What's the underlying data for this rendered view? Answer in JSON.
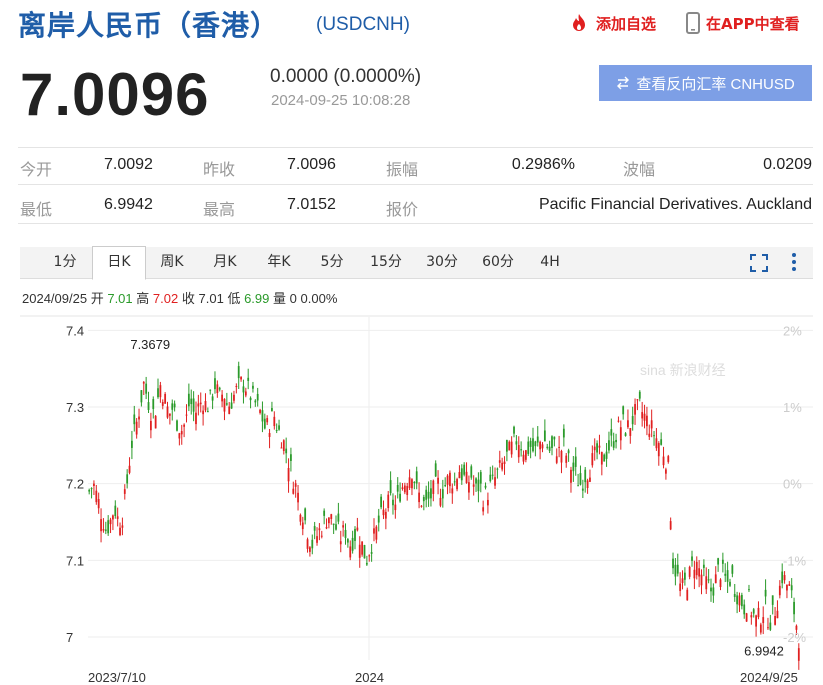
{
  "header": {
    "title": "离岸人民币（香港）",
    "code": "(USDCNH)",
    "add_favorite": "添加自选",
    "view_in_app": "在APP中查看"
  },
  "quote": {
    "price": "7.0096",
    "change": "0.0000 (0.0000%)",
    "timestamp": "2024-09-25 10:08:28",
    "reverse_button": "查看反向汇率 CNHUSD"
  },
  "stats": {
    "open_label": "今开",
    "open": "7.0092",
    "prev_close_label": "昨收",
    "prev_close": "7.0096",
    "amplitude_label": "振幅",
    "amplitude": "0.2986%",
    "range_label": "波幅",
    "range": "0.0209",
    "low_label": "最低",
    "low": "6.9942",
    "high_label": "最高",
    "high": "7.0152",
    "quote_label": "报价",
    "quote_source": "Pacific Financial Derivatives. Auckland"
  },
  "tabs": [
    "1分",
    "日K",
    "周K",
    "月K",
    "年K",
    "5分",
    "15分",
    "30分",
    "60分",
    "4H"
  ],
  "active_tab": "日K",
  "ohlc": {
    "date": "2024/09/25",
    "open_label": "开",
    "open": "7.01",
    "high_label": "高",
    "high": "7.02",
    "close_label": "收",
    "close": "7.01",
    "low_label": "低",
    "low": "6.99",
    "volume_label": "量",
    "volume": "0",
    "pct": "0.00%"
  },
  "watermark": "sina 新浪财经",
  "colors": {
    "up": "#e02020",
    "down": "#2a9a2a",
    "brand": "#1f5da8",
    "button": "#7d9fe6"
  },
  "chart_data": {
    "type": "candlestick",
    "yticks": [
      "7.4",
      "7.3",
      "7.2",
      "7.1",
      "7"
    ],
    "ytick_values": [
      7.4,
      7.3,
      7.2,
      7.1,
      7.0
    ],
    "right_ticks": [
      "2%",
      "1%",
      "0%",
      "-1%",
      "-2%"
    ],
    "ylim": [
      6.97,
      7.42
    ],
    "xticks": [
      "2023/7/10",
      "2024",
      "2024/9/25"
    ],
    "annotations": [
      {
        "text": "7.3679",
        "index": 17,
        "value": 7.3679
      },
      {
        "text": "6.9942",
        "index": 295,
        "value": 6.9942
      }
    ],
    "close_series": [
      7.19,
      7.2,
      7.18,
      7.16,
      7.14,
      7.15,
      7.17,
      7.15,
      7.16,
      7.2,
      7.25,
      7.27,
      7.3,
      7.33,
      7.31,
      7.29,
      7.3,
      7.33,
      7.31,
      7.29,
      7.3,
      7.28,
      7.27,
      7.28,
      7.31,
      7.29,
      7.3,
      7.31,
      7.3,
      7.31,
      7.33,
      7.31,
      7.32,
      7.3,
      7.31,
      7.32,
      7.33,
      7.33,
      7.32,
      7.31,
      7.3,
      7.29,
      7.27,
      7.28,
      7.29,
      7.27,
      7.26,
      7.24,
      7.22,
      7.2,
      7.18,
      7.16,
      7.14,
      7.12,
      7.13,
      7.14,
      7.15,
      7.16,
      7.15,
      7.14,
      7.13,
      7.14,
      7.12,
      7.13,
      7.14,
      7.12,
      7.1,
      7.12,
      7.13,
      7.15,
      7.16,
      7.17,
      7.18,
      7.17,
      7.19,
      7.2,
      7.21,
      7.22,
      7.19,
      7.18,
      7.17,
      7.18,
      7.19,
      7.2,
      7.19,
      7.2,
      7.21,
      7.2,
      7.22,
      7.21,
      7.2,
      7.21,
      7.19,
      7.2,
      7.18,
      7.19,
      7.2,
      7.21,
      7.22,
      7.23,
      7.24,
      7.25,
      7.26,
      7.25,
      7.24,
      7.25,
      7.24,
      7.25,
      7.26,
      7.25,
      7.24,
      7.25,
      7.24,
      7.25,
      7.23,
      7.22,
      7.21,
      7.2,
      7.21,
      7.22,
      7.23,
      7.24,
      7.23,
      7.24,
      7.25,
      7.26,
      7.27,
      7.28,
      7.27,
      7.28,
      7.29,
      7.3,
      7.29,
      7.28,
      7.27,
      7.26,
      7.25,
      7.24,
      7.22,
      7.1,
      7.08,
      7.06,
      7.07,
      7.08,
      7.1,
      7.09,
      7.08,
      7.07,
      7.06,
      7.07,
      7.09,
      7.08,
      7.07,
      7.08,
      7.06,
      7.05,
      7.04,
      7.05,
      7.03,
      7.02,
      7.03,
      7.04,
      7.02,
      7.03,
      7.05,
      7.08,
      7.07,
      7.06,
      7.03,
      7.0
    ]
  }
}
